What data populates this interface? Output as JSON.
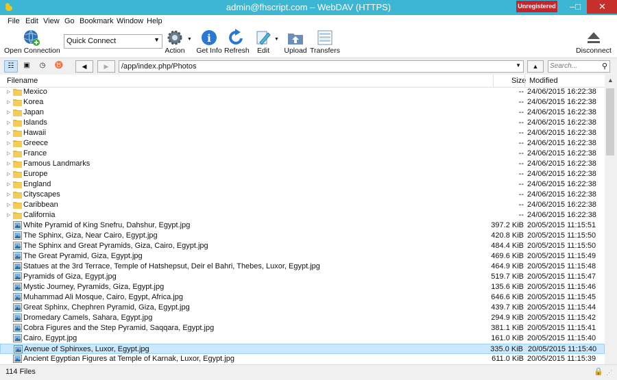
{
  "window": {
    "title": "admin@fhscript.com – WebDAV (HTTPS)",
    "badge": "Unregistered",
    "minimize": "–",
    "maximize": "□",
    "close": "✕"
  },
  "menu": [
    "File",
    "Edit",
    "View",
    "Go",
    "Bookmark",
    "Window",
    "Help"
  ],
  "toolbar": {
    "open_connection": "Open Connection",
    "quick_connect": "Quick Connect",
    "action": "Action",
    "get_info": "Get Info",
    "refresh": "Refresh",
    "edit": "Edit",
    "upload": "Upload",
    "transfers": "Transfers",
    "disconnect": "Disconnect"
  },
  "nav": {
    "path": "/app/index.php/Photos",
    "search_placeholder": "Search..."
  },
  "columns": {
    "filename": "Filename",
    "size": "Size",
    "modified": "Modified"
  },
  "folders": [
    {
      "name": "Mexico",
      "size": "--",
      "modified": "24/06/2015 16:22:38"
    },
    {
      "name": "Korea",
      "size": "--",
      "modified": "24/06/2015 16:22:38"
    },
    {
      "name": "Japan",
      "size": "--",
      "modified": "24/06/2015 16:22:38"
    },
    {
      "name": "Islands",
      "size": "--",
      "modified": "24/06/2015 16:22:38"
    },
    {
      "name": "Hawaii",
      "size": "--",
      "modified": "24/06/2015 16:22:38"
    },
    {
      "name": "Greece",
      "size": "--",
      "modified": "24/06/2015 16:22:38"
    },
    {
      "name": "France",
      "size": "--",
      "modified": "24/06/2015 16:22:38"
    },
    {
      "name": "Famous Landmarks",
      "size": "--",
      "modified": "24/06/2015 16:22:38"
    },
    {
      "name": "Europe",
      "size": "--",
      "modified": "24/06/2015 16:22:38"
    },
    {
      "name": "England",
      "size": "--",
      "modified": "24/06/2015 16:22:38"
    },
    {
      "name": "Cityscapes",
      "size": "--",
      "modified": "24/06/2015 16:22:38"
    },
    {
      "name": "Caribbean",
      "size": "--",
      "modified": "24/06/2015 16:22:38"
    },
    {
      "name": "California",
      "size": "--",
      "modified": "24/06/2015 16:22:38"
    }
  ],
  "files": [
    {
      "name": "White Pyramid of King Snefru, Dahshur, Egypt.jpg",
      "size": "397.2 KiB",
      "modified": "20/05/2015 11:15:51"
    },
    {
      "name": "The Sphinx, Giza, Near Cairo, Egypt.jpg",
      "size": "420.8 KiB",
      "modified": "20/05/2015 11:15:50"
    },
    {
      "name": "The Sphinx and Great Pyramids, Giza, Cairo, Egypt.jpg",
      "size": "484.4 KiB",
      "modified": "20/05/2015 11:15:50"
    },
    {
      "name": "The Great Pyramid, Giza, Egypt.jpg",
      "size": "469.6 KiB",
      "modified": "20/05/2015 11:15:49"
    },
    {
      "name": "Statues at the 3rd Terrace, Temple of Hatshepsut, Deir el Bahri, Thebes, Luxor, Egypt.jpg",
      "size": "464.9 KiB",
      "modified": "20/05/2015 11:15:48"
    },
    {
      "name": "Pyramids of Giza, Egypt.jpg",
      "size": "519.7 KiB",
      "modified": "20/05/2015 11:15:47"
    },
    {
      "name": "Mystic Journey, Pyramids, Giza, Egypt.jpg",
      "size": "135.6 KiB",
      "modified": "20/05/2015 11:15:46"
    },
    {
      "name": "Muhammad Ali Mosque, Cairo, Egypt, Africa.jpg",
      "size": "646.6 KiB",
      "modified": "20/05/2015 11:15:45"
    },
    {
      "name": "Great Sphinx, Chephren Pyramid, Giza, Egypt.jpg",
      "size": "439.7 KiB",
      "modified": "20/05/2015 11:15:44"
    },
    {
      "name": "Dromedary Camels, Sahara, Egypt.jpg",
      "size": "294.9 KiB",
      "modified": "20/05/2015 11:15:42"
    },
    {
      "name": "Cobra Figures and the Step Pyramid, Saqqara, Egypt.jpg",
      "size": "381.1 KiB",
      "modified": "20/05/2015 11:15:41"
    },
    {
      "name": "Cairo, Egypt.jpg",
      "size": "161.0 KiB",
      "modified": "20/05/2015 11:15:40"
    },
    {
      "name": "Avenue of Sphinxes, Luxor, Egypt.jpg",
      "size": "335.0 KiB",
      "modified": "20/05/2015 11:15:40",
      "selected": true
    },
    {
      "name": "Ancient Egyptian Figures at Temple of Karnak, Luxor, Egypt.jpg",
      "size": "611.0 KiB",
      "modified": "20/05/2015 11:15:39"
    }
  ],
  "status": {
    "count": "114 Files"
  },
  "colors": {
    "titlebar": "#3cb6d3",
    "badge": "#c1272d",
    "selection": "#cce8ff",
    "folder": "#e8b936"
  }
}
